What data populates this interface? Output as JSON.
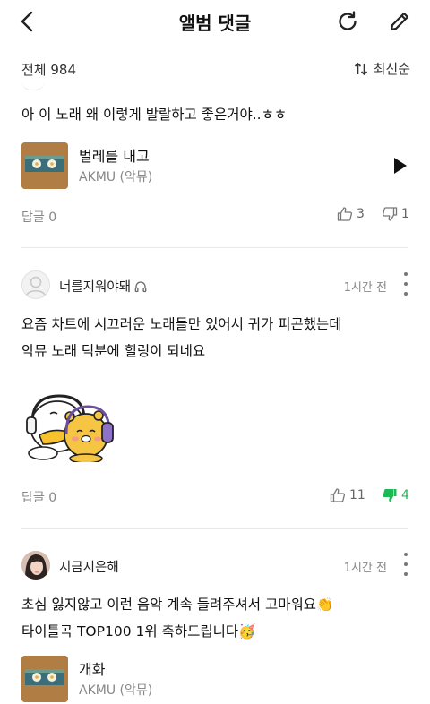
{
  "header": {
    "title": "앨범 댓글",
    "back_icon": "chevron-left-icon",
    "refresh_icon": "refresh-icon",
    "edit_icon": "pencil-icon"
  },
  "summary": {
    "total_label": "전체 984",
    "sort_label": "최신순",
    "sort_icon": "sort-arrows-icon"
  },
  "colors": {
    "accent_green": "#1db954",
    "text_gray": "#888888",
    "divider": "#e9e9e9"
  },
  "comments": [
    {
      "text": "아 이 노래 왜 이렇게 발랄하고 좋은거야..ㅎㅎ",
      "song": {
        "title": "벌레를 내고",
        "artist": "AKMU (악뮤)"
      },
      "reply_label": "답글 0",
      "likes": "3",
      "dislikes": "1"
    },
    {
      "username": "너를지워야돼",
      "listening_icon": "headphones-icon",
      "time": "1시간 전",
      "lines": [
        "요즘 차트에 시끄러운 노래들만 있어서 귀가 피곤했는데",
        "악뮤 노래 덕분에 힐링이 되네요"
      ],
      "sticker": "kakao-friends-headphones-sticker",
      "reply_label": "답글 0",
      "likes": "11",
      "dislikes": "4"
    },
    {
      "username": "지금지은해",
      "time": "1시간 전",
      "lines": [
        "초심 잃지않고 이런 음악 계속 들려주셔서 고마워요👏",
        "타이틀곡 TOP100 1위 축하드립니다🥳"
      ],
      "song": {
        "title": "개화",
        "artist": "AKMU (악뮤)"
      }
    }
  ]
}
